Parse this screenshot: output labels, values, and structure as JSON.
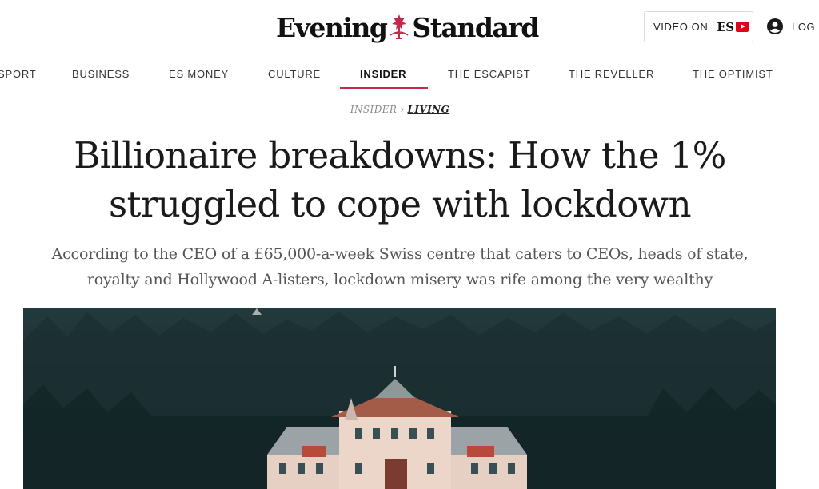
{
  "header": {
    "logo_left": "Evening",
    "logo_right": "Standard",
    "video_label": "VIDEO ON",
    "video_brand": "ES",
    "login_label": "LOG IN"
  },
  "nav": {
    "items": [
      {
        "label": "SPORT"
      },
      {
        "label": "BUSINESS"
      },
      {
        "label": "ES MONEY"
      },
      {
        "label": "CULTURE"
      },
      {
        "label": "INSIDER"
      },
      {
        "label": "THE ESCAPIST"
      },
      {
        "label": "THE REVELLER"
      },
      {
        "label": "THE OPTIMIST"
      }
    ],
    "active": "INSIDER"
  },
  "breadcrumb": {
    "parent": "INSIDER",
    "separator": "›",
    "current": "LIVING"
  },
  "article": {
    "headline": "Billionaire breakdowns: How the 1% struggled to cope with lockdown",
    "standfirst": "According to the CEO of a £65,000-a-week Swiss centre that caters to CEOs, heads of state, royalty and Hollywood A-listers, lockdown misery was rife among the very wealthy"
  },
  "colors": {
    "accent": "#c4284b",
    "video_brand_red": "#e2001a"
  },
  "icons": [
    "crest-icon",
    "play-icon",
    "user-icon"
  ]
}
